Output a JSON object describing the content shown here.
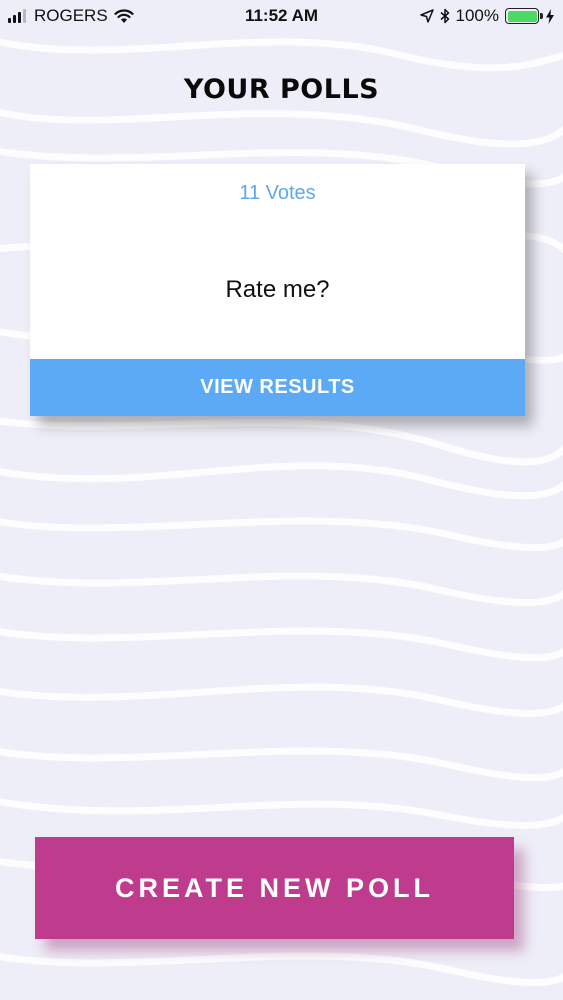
{
  "status_bar": {
    "carrier": "ROGERS",
    "time": "11:52 AM",
    "battery_percent": "100%",
    "battery_level": 1.0,
    "icons": [
      "signal-icon",
      "wifi-icon",
      "location-arrow-icon",
      "bluetooth-icon",
      "battery-icon",
      "charging-bolt-icon"
    ]
  },
  "header": {
    "title": "YOUR POLLS"
  },
  "polls": [
    {
      "votes_label": "11 Votes",
      "question": "Rate me?",
      "action_label": "VIEW RESULTS"
    }
  ],
  "create_button": {
    "label": "CREATE NEW POLL"
  },
  "colors": {
    "background": "#eeeef8",
    "votes_text": "#5ba8f0",
    "view_results_bg": "#5ca9f5",
    "create_button_bg": "#bf3b8e"
  }
}
